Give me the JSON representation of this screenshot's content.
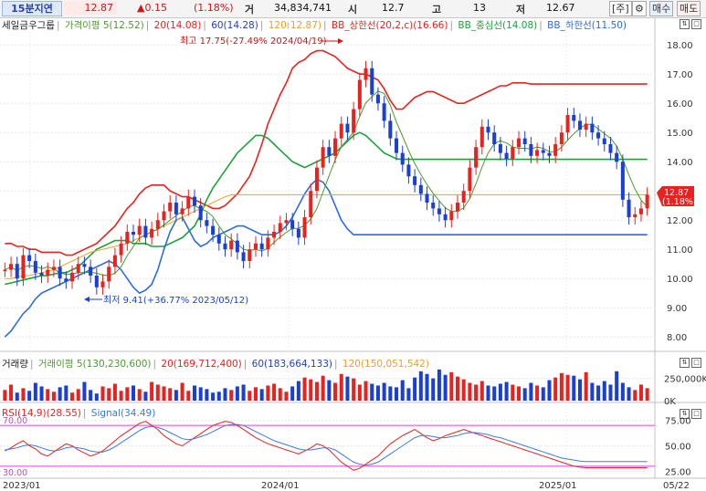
{
  "topbar": {
    "period": "15분지연",
    "price": "12.87",
    "change": "▲0.15",
    "rate": "(1.18%)",
    "volume_label": "거",
    "volume": "34,834,741",
    "open_label": "시",
    "open": "12.7",
    "high_label": "고",
    "high": "13",
    "low_label": "저",
    "low": "12.67",
    "btn_stock": "[주]",
    "btn_settings": "⚙",
    "btn_buy": "매수",
    "btn_sell": "매도"
  },
  "legend_main": {
    "name": "세일금우그룹",
    "ma5": "가격이평 5(12.52)",
    "ma20": "20(14.08)",
    "ma60": "60(14.28)",
    "ma120": "120(12.87)",
    "bb_upper": "BB_상한선(20,2,c)(16.66)",
    "bb_mid": "BB_중심선(14.08)",
    "bb_lower": "BB_하한선(11.50)"
  },
  "legend_volume": {
    "name": "거래량",
    "ma5": "거래이평 5(130,230,600)",
    "ma20": "20(169,712,400)",
    "ma60": "60(183,664,133)",
    "ma120": "120(150,051,542)"
  },
  "legend_rsi": {
    "rsi": "RSI(14,9)(28.55)",
    "signal": "Signal(34.49)"
  },
  "annotations": {
    "high_note": "최고 17.75(-27.49% 2024/04/19)",
    "low_note": "최저 9.41(+36.77% 2023/05/12)",
    "current_price": "12.87",
    "current_rate": "(1.18%)"
  },
  "axes": {
    "x_labels": [
      "2023/01",
      "2024/01",
      "2025/01",
      "05/22"
    ],
    "price_ticks": [
      "18.00",
      "17.00",
      "16.00",
      "15.00",
      "14.00",
      "13.00",
      "12.00",
      "11.00",
      "10.00",
      "9.00",
      "8.00"
    ],
    "volume_ticks": [
      "250,000K",
      "0K"
    ],
    "rsi_ticks": [
      "75.00",
      "50.00",
      "25.00"
    ],
    "rsi_levels": [
      "70.00",
      "30.00"
    ]
  },
  "colors": {
    "up": "#e8231f",
    "down": "#1a3fd8",
    "ma5": "#4a9c2a",
    "ma20": "#e8231f",
    "ma60": "#1f3fd0",
    "ma120": "#f0a020",
    "bb_upper": "#e8231f",
    "bb_mid": "#1fa03a",
    "bb_lower": "#2d6be0",
    "rsi": "#e8231f",
    "signal": "#3a7be0",
    "rsi_level": "#e040e0"
  },
  "chart_data": [
    {
      "type": "candlestick",
      "title": "세일금우그룹",
      "ylim": [
        7.6,
        18.6
      ],
      "x_range": [
        "2023/01",
        "2025/05/22"
      ],
      "high": {
        "value": 17.75,
        "date": "2024/04/19"
      },
      "low": {
        "value": 9.41,
        "date": "2023/05/12"
      },
      "last": 12.87,
      "closes": [
        10.3,
        10.5,
        10.0,
        10.8,
        10.6,
        10.2,
        10.1,
        10.3,
        10.4,
        10.0,
        9.9,
        10.2,
        10.5,
        10.4,
        10.1,
        9.7,
        9.9,
        10.4,
        10.8,
        11.2,
        11.6,
        11.5,
        11.8,
        11.4,
        11.7,
        12.0,
        12.3,
        12.6,
        12.2,
        12.4,
        12.8,
        12.5,
        12.0,
        11.8,
        11.5,
        11.2,
        11.0,
        11.3,
        10.9,
        10.6,
        11.0,
        11.2,
        11.0,
        11.4,
        11.6,
        11.9,
        12.0,
        11.7,
        11.4,
        12.1,
        13.0,
        13.8,
        14.5,
        14.2,
        14.8,
        15.3,
        15.0,
        15.8,
        16.8,
        17.2,
        16.3,
        16.0,
        15.4,
        14.8,
        14.3,
        13.9,
        13.5,
        13.2,
        12.9,
        12.6,
        12.4,
        12.2,
        12.0,
        12.3,
        12.6,
        13.0,
        13.8,
        14.5,
        15.2,
        15.0,
        14.6,
        14.3,
        14.1,
        14.5,
        14.8,
        14.6,
        14.2,
        14.4,
        14.3,
        14.2,
        14.6,
        15.0,
        15.6,
        15.4,
        15.1,
        15.3,
        15.0,
        14.8,
        14.6,
        14.3,
        14.0,
        12.7,
        12.1,
        12.2,
        12.4,
        12.87
      ],
      "series": [
        {
          "name": "BB_상한선",
          "values": [
            11.2,
            11.2,
            11.1,
            11.1,
            11.0,
            11.0,
            10.9,
            10.9,
            10.9,
            10.9,
            10.8,
            10.8,
            10.9,
            11.0,
            11.1,
            11.2,
            11.4,
            11.6,
            11.8,
            12.1,
            12.4,
            12.6,
            12.9,
            13.1,
            13.2,
            13.2,
            13.2,
            13.0,
            12.9,
            12.8,
            12.8,
            12.7,
            12.6,
            12.5,
            12.4,
            12.4,
            12.5,
            12.7,
            12.9,
            13.2,
            13.5,
            14.0,
            14.6,
            15.3,
            15.8,
            16.3,
            16.7,
            17.2,
            17.4,
            17.5,
            17.7,
            17.8,
            17.8,
            17.7,
            17.6,
            17.4,
            17.2,
            17.1,
            17.0,
            17.0,
            16.9,
            16.8,
            16.5,
            16.1,
            15.8,
            15.8,
            16.0,
            16.2,
            16.3,
            16.4,
            16.4,
            16.3,
            16.2,
            16.1,
            16.0,
            16.0,
            16.1,
            16.2,
            16.3,
            16.4,
            16.5,
            16.6,
            16.6,
            16.7,
            16.7,
            16.7,
            16.66,
            16.66,
            16.66,
            16.66,
            16.66,
            16.66,
            16.66,
            16.66,
            16.66,
            16.66,
            16.66,
            16.66,
            16.66,
            16.66,
            16.66,
            16.66,
            16.66,
            16.66,
            16.66,
            16.66
          ]
        },
        {
          "name": "BB_중심선",
          "values": [
            9.8,
            9.85,
            9.9,
            9.95,
            10.0,
            10.05,
            10.1,
            10.1,
            10.15,
            10.2,
            10.2,
            10.3,
            10.4,
            10.6,
            10.8,
            11.0,
            11.1,
            11.2,
            11.3,
            11.3,
            11.3,
            11.2,
            11.2,
            11.2,
            11.1,
            11.1,
            11.1,
            11.2,
            11.3,
            11.4,
            11.6,
            11.8,
            12.2,
            12.7,
            13.1,
            13.4,
            13.7,
            14.0,
            14.3,
            14.5,
            14.7,
            14.9,
            14.9,
            14.8,
            14.6,
            14.4,
            14.2,
            14.0,
            13.9,
            13.8,
            13.9,
            14.0,
            14.1,
            14.2,
            14.3,
            14.5,
            14.7,
            14.9,
            15.0,
            14.9,
            14.7,
            14.5,
            14.3,
            14.2,
            14.1,
            14.08,
            14.08,
            14.08,
            14.08,
            14.08,
            14.08,
            14.08,
            14.08,
            14.08,
            14.08,
            14.08,
            14.08,
            14.08,
            14.08,
            14.08,
            14.08,
            14.08,
            14.08,
            14.08,
            14.08,
            14.08,
            14.08,
            14.08,
            14.08,
            14.08,
            14.08,
            14.08,
            14.08,
            14.08,
            14.08,
            14.08,
            14.08,
            14.08,
            14.08,
            14.08,
            14.08,
            14.08,
            14.08,
            14.08,
            14.08,
            14.08
          ]
        },
        {
          "name": "BB_하한선",
          "values": [
            8.0,
            8.2,
            8.5,
            8.8,
            9.0,
            9.3,
            9.5,
            9.6,
            9.7,
            9.8,
            9.9,
            10.0,
            10.1,
            10.2,
            10.3,
            10.4,
            10.5,
            10.6,
            10.5,
            10.3,
            10.0,
            9.7,
            9.5,
            9.6,
            9.8,
            10.3,
            11.0,
            11.6,
            12.0,
            12.1,
            11.7,
            11.3,
            11.1,
            11.2,
            11.4,
            11.5,
            11.6,
            11.7,
            11.8,
            11.8,
            11.7,
            11.6,
            11.5,
            11.5,
            11.5,
            11.6,
            11.8,
            12.1,
            12.5,
            12.9,
            13.2,
            13.4,
            13.3,
            13.0,
            12.5,
            12.0,
            11.7,
            11.5,
            11.5,
            11.5,
            11.5,
            11.5,
            11.5,
            11.5,
            11.5,
            11.5,
            11.5,
            11.5,
            11.5,
            11.5,
            11.5,
            11.5,
            11.5,
            11.5,
            11.5,
            11.5,
            11.5,
            11.5,
            11.5,
            11.5,
            11.5,
            11.5,
            11.5,
            11.5,
            11.5,
            11.5,
            11.5,
            11.5,
            11.5,
            11.5,
            11.5,
            11.5,
            11.5,
            11.5,
            11.5,
            11.5,
            11.5,
            11.5,
            11.5,
            11.5,
            11.5,
            11.5,
            11.5,
            11.5,
            11.5,
            11.5
          ]
        },
        {
          "name": "120",
          "values": [
            10.0,
            10.0,
            10.05,
            10.1,
            10.1,
            10.15,
            10.2,
            10.25,
            10.3,
            10.4,
            10.5,
            10.6,
            10.7,
            10.8,
            10.9,
            10.95,
            11.0,
            11.05,
            11.1,
            11.15,
            11.2,
            11.3,
            11.4,
            11.5,
            11.6,
            11.7,
            11.8,
            11.9,
            12.0,
            12.1,
            12.2,
            12.3,
            12.4,
            12.5,
            12.6,
            12.7,
            12.8,
            12.87,
            12.87,
            12.87,
            12.87,
            12.87,
            12.87,
            12.87,
            12.87,
            12.87,
            12.87,
            12.87,
            12.87,
            12.87,
            12.87,
            12.87,
            12.87,
            12.87,
            12.87,
            12.87,
            12.87,
            12.87,
            12.87,
            12.87,
            12.87,
            12.87,
            12.87,
            12.87,
            12.87,
            12.87,
            12.87,
            12.87,
            12.87,
            12.87,
            12.87,
            12.87,
            12.87,
            12.87,
            12.87,
            12.87,
            12.87,
            12.87,
            12.87,
            12.87,
            12.87,
            12.87,
            12.87,
            12.87,
            12.87,
            12.87,
            12.87,
            12.87,
            12.87,
            12.87,
            12.87,
            12.87,
            12.87,
            12.87,
            12.87,
            12.87,
            12.87,
            12.87,
            12.87,
            12.87,
            12.87,
            12.87,
            12.87,
            12.87,
            12.87,
            12.87
          ]
        }
      ]
    },
    {
      "type": "bar",
      "title": "거래량",
      "ylim": [
        0,
        400000
      ],
      "values": [
        120000,
        180000,
        90000,
        140000,
        110000,
        200000,
        160000,
        130000,
        100000,
        150000,
        170000,
        90000,
        130000,
        210000,
        120000,
        80000,
        160000,
        140000,
        190000,
        110000,
        150000,
        170000,
        130000,
        100000,
        210000,
        180000,
        160000,
        140000,
        120000,
        200000,
        110000,
        170000,
        150000,
        130000,
        90000,
        100000,
        140000,
        120000,
        160000,
        180000,
        110000,
        150000,
        130000,
        170000,
        190000,
        140000,
        100000,
        160000,
        220000,
        260000,
        240000,
        210000,
        280000,
        230000,
        200000,
        300000,
        270000,
        250000,
        180000,
        220000,
        190000,
        170000,
        200000,
        160000,
        150000,
        230000,
        140000,
        260000,
        330000,
        300000,
        250000,
        350000,
        290000,
        320000,
        270000,
        240000,
        200000,
        180000,
        220000,
        170000,
        160000,
        190000,
        210000,
        180000,
        160000,
        140000,
        200000,
        170000,
        150000,
        230000,
        260000,
        310000,
        290000,
        280000,
        240000,
        320000,
        200000,
        170000,
        220000,
        180000,
        330000,
        200000,
        150000,
        120000,
        180000,
        140000
      ]
    },
    {
      "type": "line",
      "title": "RSI",
      "ylim": [
        20,
        80
      ],
      "series": [
        {
          "name": "RSI(14,9)",
          "values": [
            45,
            48,
            52,
            55,
            50,
            47,
            42,
            40,
            44,
            48,
            52,
            50,
            46,
            43,
            40,
            42,
            45,
            50,
            55,
            60,
            64,
            68,
            72,
            74,
            70,
            66,
            60,
            56,
            52,
            50,
            54,
            58,
            62,
            66,
            70,
            72,
            74,
            73,
            70,
            66,
            62,
            58,
            55,
            52,
            50,
            48,
            46,
            44,
            42,
            45,
            48,
            52,
            50,
            46,
            40,
            34,
            30,
            26,
            28,
            32,
            36,
            40,
            46,
            52,
            56,
            60,
            63,
            66,
            62,
            58,
            55,
            57,
            60,
            62,
            64,
            66,
            64,
            62,
            60,
            58,
            56,
            54,
            52,
            50,
            48,
            46,
            44,
            42,
            40,
            38,
            36,
            34,
            32,
            30,
            29,
            28.55,
            28.55,
            28.55,
            28.55,
            28.55,
            28.55,
            28.55,
            28.55,
            28.55,
            28.55,
            28.55
          ]
        },
        {
          "name": "Signal",
          "values": [
            46,
            47,
            48,
            50,
            51,
            50,
            48,
            46,
            45,
            46,
            48,
            49,
            48,
            47,
            45,
            44,
            44,
            46,
            49,
            53,
            57,
            61,
            65,
            68,
            69,
            68,
            66,
            63,
            60,
            57,
            56,
            57,
            59,
            61,
            64,
            67,
            70,
            71,
            71,
            70,
            67,
            64,
            61,
            58,
            55,
            53,
            51,
            49,
            47,
            46,
            46,
            47,
            48,
            48,
            46,
            42,
            38,
            34,
            32,
            31,
            32,
            34,
            38,
            42,
            46,
            50,
            54,
            58,
            60,
            60,
            59,
            58,
            58,
            59,
            60,
            62,
            63,
            63,
            62,
            61,
            59,
            58,
            56,
            54,
            52,
            50,
            48,
            46,
            44,
            42,
            40,
            38,
            37,
            36,
            35,
            34.49,
            34.49,
            34.49,
            34.49,
            34.49,
            34.49,
            34.49,
            34.49,
            34.49,
            34.49,
            34.49
          ]
        }
      ]
    }
  ]
}
